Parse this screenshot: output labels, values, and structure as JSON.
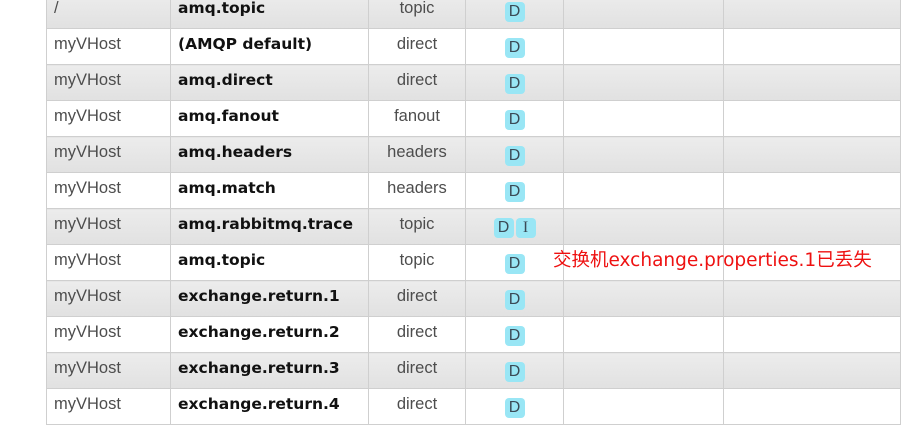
{
  "exchanges": [
    {
      "vhost": "/",
      "name": "amq.topic",
      "type": "topic",
      "features": [
        "D"
      ]
    },
    {
      "vhost": "myVHost",
      "name": "(AMQP default)",
      "type": "direct",
      "features": [
        "D"
      ]
    },
    {
      "vhost": "myVHost",
      "name": "amq.direct",
      "type": "direct",
      "features": [
        "D"
      ]
    },
    {
      "vhost": "myVHost",
      "name": "amq.fanout",
      "type": "fanout",
      "features": [
        "D"
      ]
    },
    {
      "vhost": "myVHost",
      "name": "amq.headers",
      "type": "headers",
      "features": [
        "D"
      ]
    },
    {
      "vhost": "myVHost",
      "name": "amq.match",
      "type": "headers",
      "features": [
        "D"
      ]
    },
    {
      "vhost": "myVHost",
      "name": "amq.rabbitmq.trace",
      "type": "topic",
      "features": [
        "D",
        "I"
      ]
    },
    {
      "vhost": "myVHost",
      "name": "amq.topic",
      "type": "topic",
      "features": [
        "D"
      ]
    },
    {
      "vhost": "myVHost",
      "name": "exchange.return.1",
      "type": "direct",
      "features": [
        "D"
      ]
    },
    {
      "vhost": "myVHost",
      "name": "exchange.return.2",
      "type": "direct",
      "features": [
        "D"
      ]
    },
    {
      "vhost": "myVHost",
      "name": "exchange.return.3",
      "type": "direct",
      "features": [
        "D"
      ]
    },
    {
      "vhost": "myVHost",
      "name": "exchange.return.4",
      "type": "direct",
      "features": [
        "D"
      ]
    }
  ],
  "annotation": {
    "text": "交换机exchange.properties.1已丢失",
    "color": "#ee1111"
  },
  "colors": {
    "badge_bg": "#99e6f5",
    "row_alt_bg": "#e6e6e6",
    "border": "#cfcfcf"
  }
}
